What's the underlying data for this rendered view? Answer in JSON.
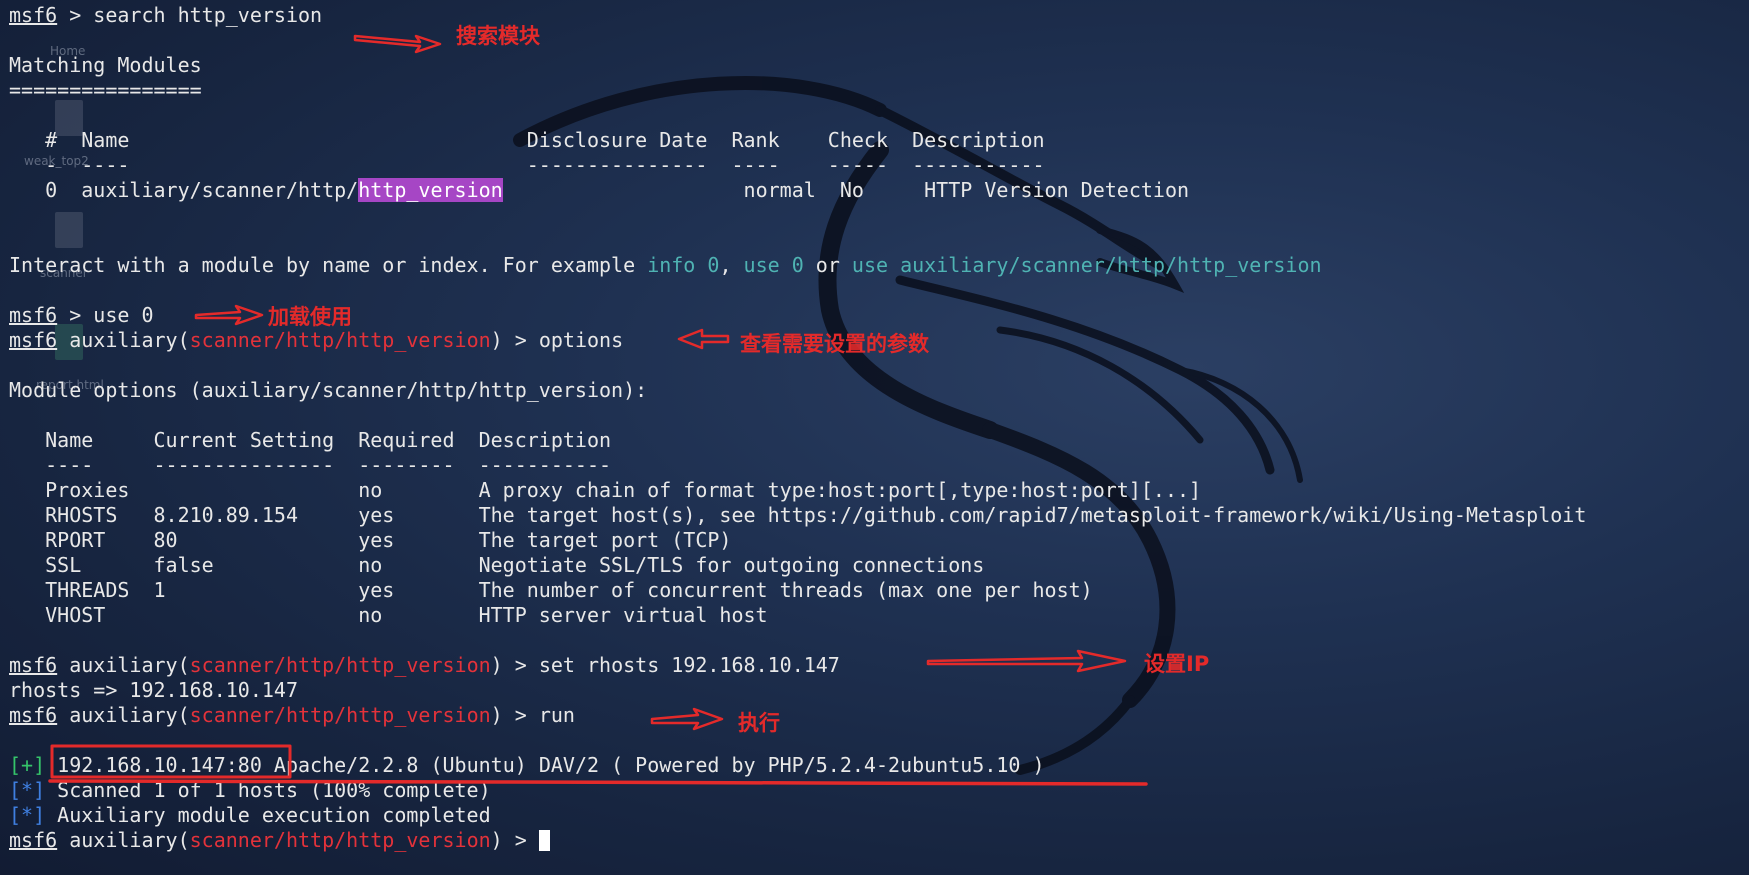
{
  "desktop": {
    "labels": [
      "Home",
      "weak_top2",
      "scanner",
      "report.html"
    ]
  },
  "colors": {
    "module_red": "#e3323a",
    "example_cyan": "#4fb3b3",
    "status_blue": "#3f7fe0",
    "status_green": "#35c46a",
    "highlight_purple": "#a646c5",
    "annotation_red": "#e42a2a"
  },
  "terminal": {
    "prompt": "msf6",
    "module_path": "scanner/http/http_version",
    "search_cmd": " > search http_version",
    "matching_title": "Matching Modules",
    "matching_rule": "================",
    "search_table": {
      "header": "   #  Name                                 Disclosure Date  Rank    Check  Description",
      "rule": "   -  ----                                 ---------------  ----    -----  -----------",
      "row_index": "   0  ",
      "row_path": "auxiliary/scanner/http/",
      "row_match": "http_version",
      "row_rest": "                    normal  No     HTTP Version Detection"
    },
    "interact_prefix": "Interact with a module by name or index. For example ",
    "interact_info": "info 0",
    "interact_sep1": ", ",
    "interact_use": "use 0",
    "interact_sep2": " or ",
    "interact_use_full": "use auxiliary/scanner/http/http_version",
    "use_cmd": " > use 0",
    "aux_open": " auxiliary(",
    "aux_close": ")",
    "options_cmd": " > options",
    "module_options_title": "Module options (auxiliary/scanner/http/http_version):",
    "options_table": {
      "header": "   Name     Current Setting  Required  Description",
      "rule": "   ----     ---------------  --------  -----------",
      "rows": [
        "   Proxies                   no        A proxy chain of format type:host:port[,type:host:port][...]",
        "   RHOSTS   8.210.89.154     yes       The target host(s), see https://github.com/rapid7/metasploit-framework/wiki/Using-Metasploit",
        "   RPORT    80               yes       The target port (TCP)",
        "   SSL      false            no        Negotiate SSL/TLS for outgoing connections",
        "   THREADS  1                yes       The number of concurrent threads (max one per host)",
        "   VHOST                     no        HTTP server virtual host"
      ]
    },
    "set_cmd": " > set rhosts 192.168.10.147",
    "set_result": "rhosts => 192.168.10.147",
    "run_cmd": " > run",
    "result_tag": "[+]",
    "result_host": "192.168.10.147:80",
    "result_text": " Apache/2.2.8 (Ubuntu) DAV/2 ( Powered by PHP/5.2.4-2ubuntu5.10 )",
    "info_tag": "[*]",
    "scanned_text": " Scanned 1 of 1 hosts (100% complete)",
    "completed_text": " Auxiliary module execution completed",
    "final_prompt_end": " > "
  },
  "annotations": {
    "search": "搜索模块",
    "load": "加载使用",
    "options": "查看需要设置的参数",
    "set_ip": "设置IP",
    "run": "执行"
  }
}
